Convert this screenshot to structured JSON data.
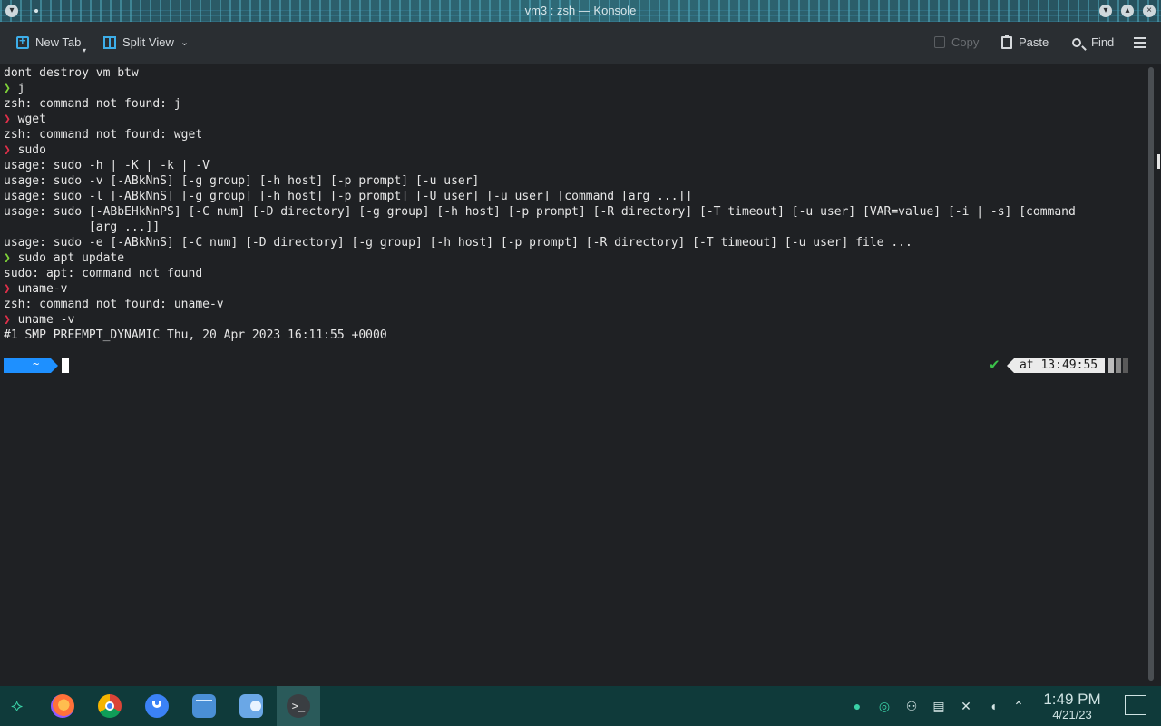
{
  "window": {
    "title": "vm3 : zsh — Konsole"
  },
  "toolbar": {
    "new_tab": "New Tab",
    "split_view": "Split View",
    "copy": "Copy",
    "paste": "Paste",
    "find": "Find"
  },
  "terminal": {
    "lines": [
      {
        "prompt": "",
        "text": "dont destroy vm btw"
      },
      {
        "prompt": "❯",
        "text": " j",
        "ok": true
      },
      {
        "prompt": "",
        "text": "zsh: command not found: j"
      },
      {
        "prompt": "❯",
        "text": " wget"
      },
      {
        "prompt": "",
        "text": "zsh: command not found: wget"
      },
      {
        "prompt": "❯",
        "text": " sudo"
      },
      {
        "prompt": "",
        "text": "usage: sudo -h | -K | -k | -V"
      },
      {
        "prompt": "",
        "text": "usage: sudo -v [-ABkNnS] [-g group] [-h host] [-p prompt] [-u user]"
      },
      {
        "prompt": "",
        "text": "usage: sudo -l [-ABkNnS] [-g group] [-h host] [-p prompt] [-U user] [-u user] [command [arg ...]]"
      },
      {
        "prompt": "",
        "text": "usage: sudo [-ABbEHkNnPS] [-C num] [-D directory] [-g group] [-h host] [-p prompt] [-R directory] [-T timeout] [-u user] [VAR=value] [-i | -s] [command"
      },
      {
        "prompt": "",
        "text": "            [arg ...]]"
      },
      {
        "prompt": "",
        "text": "usage: sudo -e [-ABkNnS] [-C num] [-D directory] [-g group] [-h host] [-p prompt] [-R directory] [-T timeout] [-u user] file ..."
      },
      {
        "prompt": "❯",
        "text": " sudo apt update",
        "ok": true
      },
      {
        "prompt": "",
        "text": "sudo: apt: command not found"
      },
      {
        "prompt": "❯",
        "text": " uname-v"
      },
      {
        "prompt": "",
        "text": "zsh: command not found: uname-v"
      },
      {
        "prompt": "❯",
        "text": " uname -v"
      },
      {
        "prompt": "",
        "text": "#1 SMP PREEMPT_DYNAMIC Thu, 20 Apr 2023 16:11:55 +0000"
      }
    ],
    "prompt_dir": "~",
    "status_check": "✔",
    "prompt_time": "at 13:49:55"
  },
  "taskbar": {
    "launcher_icon": "application-launcher-icon",
    "apps": [
      "firefox-icon",
      "chrome-icon",
      "shield-app-icon",
      "files-icon",
      "toggle-app-icon",
      "konsole-icon"
    ],
    "konsole_glyph": ">_",
    "clock_time": "1:49 PM",
    "clock_date": "4/21/23"
  },
  "colors": {
    "accent": "#3daee9",
    "prompt_error": "#e0304a",
    "prompt_ok": "#7fd33a",
    "prompt_dir_bg": "#1e90ff",
    "taskbar_bg": "#0f3a3a"
  }
}
